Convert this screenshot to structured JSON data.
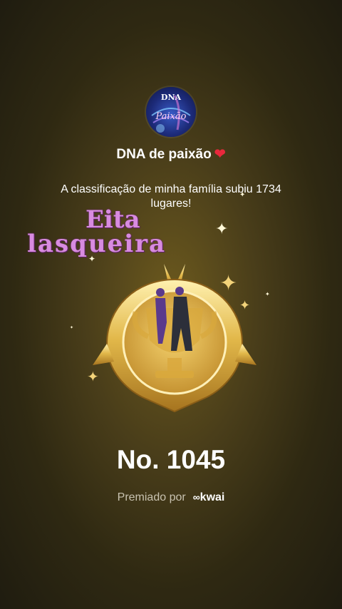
{
  "profile": {
    "avatar_text_top": "DNA",
    "avatar_text_bottom": "Paixão",
    "name": "DNA de paixão",
    "name_emoji": "❤"
  },
  "announcement": {
    "message": "A classificação de minha família subiu 1734 lugares!"
  },
  "sticker": {
    "line1": "Eita",
    "line2": "lasqueira"
  },
  "badge": {
    "icon": "gold-trophy-badge"
  },
  "rank": {
    "label": "No. 1045"
  },
  "footer": {
    "awarded_by": "Premiado por",
    "brand": "kwai",
    "brand_icon": "kwai-logo-icon"
  },
  "colors": {
    "background": "#3a3216",
    "gold": "#e2b84a",
    "heart": "#e8283c",
    "sticker_pink": "#d88be0"
  }
}
